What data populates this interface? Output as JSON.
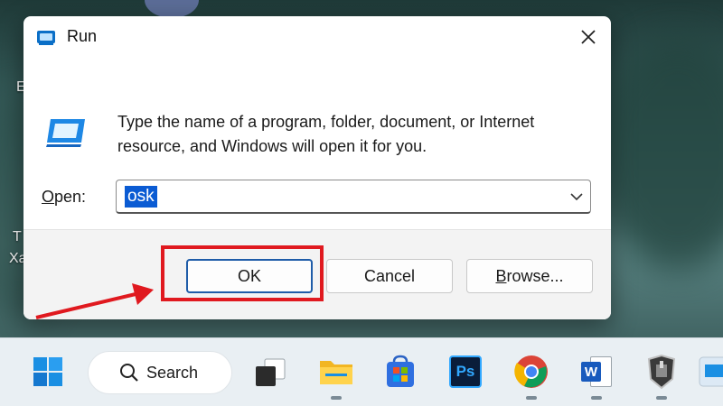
{
  "desktop": {
    "label_1": "E",
    "label_2": "T",
    "label_3": "Xa"
  },
  "dialog": {
    "title": "Run",
    "description": "Type the name of a program, folder, document, or Internet resource, and Windows will open it for you.",
    "open_label_accel": "O",
    "open_label_rest": "pen:",
    "open_value": "osk",
    "buttons": {
      "ok": "OK",
      "cancel": "Cancel",
      "browse_accel": "B",
      "browse_rest": "rowse..."
    }
  },
  "taskbar": {
    "search_label": "Search",
    "items": [
      "start-icon",
      "search",
      "task-view-icon",
      "file-explorer-icon",
      "microsoft-store-icon",
      "photoshop-icon",
      "chrome-icon",
      "word-icon",
      "world-of-tanks-icon",
      "run-app-icon"
    ],
    "photoshop_text": "Ps",
    "word_text": "W"
  },
  "colors": {
    "annotation": "#e0191f",
    "selection": "#0a5bd3",
    "ok_border": "#1f5ca8"
  }
}
